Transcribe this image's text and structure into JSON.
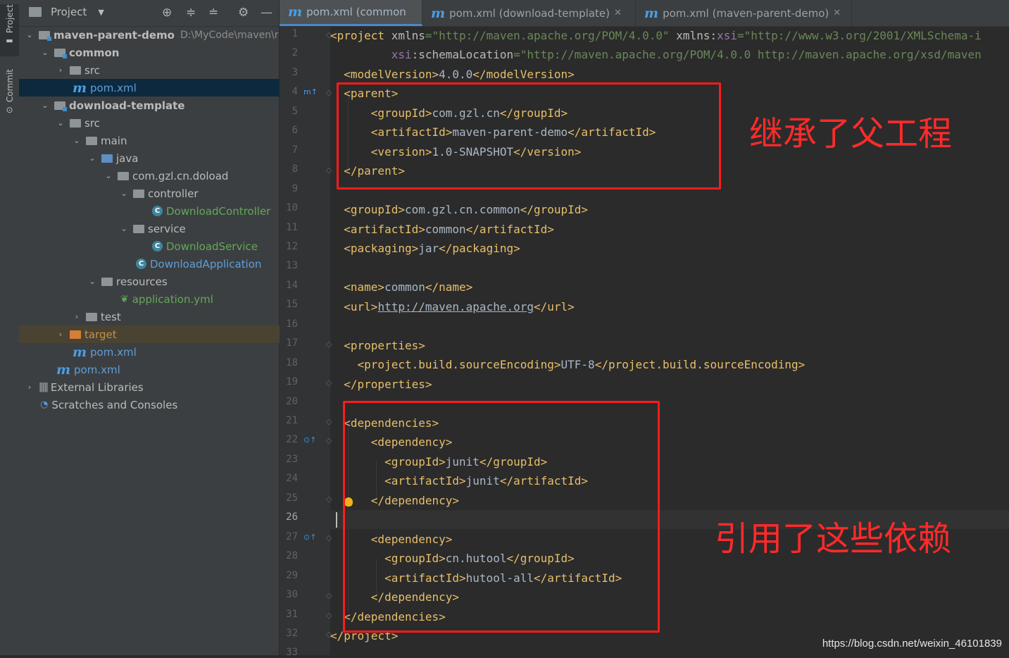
{
  "toolstrip": {
    "project_label": "Project",
    "commit_label": "Commit"
  },
  "project_panel": {
    "title": "Project",
    "tree": [
      {
        "label": "maven-parent-demo",
        "path": "D:\\MyCode\\maven\\r",
        "type": "module"
      },
      {
        "label": "common",
        "type": "module"
      },
      {
        "label": "src",
        "type": "folder"
      },
      {
        "label": "pom.xml",
        "type": "maven"
      },
      {
        "label": "download-template",
        "type": "module"
      },
      {
        "label": "src",
        "type": "folder"
      },
      {
        "label": "main",
        "type": "folder"
      },
      {
        "label": "java",
        "type": "folder"
      },
      {
        "label": "com.gzl.cn.doload",
        "type": "package"
      },
      {
        "label": "controller",
        "type": "package"
      },
      {
        "label": "DownloadController",
        "type": "class"
      },
      {
        "label": "service",
        "type": "package"
      },
      {
        "label": "DownloadService",
        "type": "class"
      },
      {
        "label": "DownloadApplication",
        "type": "app"
      },
      {
        "label": "resources",
        "type": "folder"
      },
      {
        "label": "application.yml",
        "type": "yml"
      },
      {
        "label": "test",
        "type": "folder"
      },
      {
        "label": "target",
        "type": "folder"
      },
      {
        "label": "pom.xml",
        "type": "maven"
      },
      {
        "label": "pom.xml",
        "type": "maven"
      },
      {
        "label": "External Libraries",
        "type": "lib"
      },
      {
        "label": "Scratches and Consoles",
        "type": "scratch"
      }
    ]
  },
  "editor": {
    "tabs": [
      {
        "label": "pom.xml (common",
        "active": true
      },
      {
        "label": "pom.xml (download-template)",
        "active": false
      },
      {
        "label": "pom.xml (maven-parent-demo)",
        "active": false
      }
    ],
    "current_line": 26,
    "line_numbers": [
      "1",
      "2",
      "3",
      "4",
      "5",
      "6",
      "7",
      "8",
      "9",
      "10",
      "11",
      "12",
      "13",
      "14",
      "15",
      "16",
      "17",
      "18",
      "19",
      "20",
      "21",
      "22",
      "23",
      "24",
      "25",
      "26",
      "27",
      "28",
      "29",
      "30",
      "31",
      "32",
      "33"
    ],
    "code": {
      "l1_tag": "<project ",
      "l1_attr1": "xmlns",
      "l1_val1": "=\"http://maven.apache.org/POM/4.0.0\" ",
      "l1_attr2": "xmlns:",
      "l1_ns": "xsi",
      "l1_val2": "=\"http://www.w3.org/2001/XMLSchema-i",
      "l2_ns": "xsi",
      "l2_attr": ":schemaLocation",
      "l2_val": "=\"http://maven.apache.org/POM/4.0.0 http://maven.apache.org/xsd/maven",
      "l3_open": "<modelVersion>",
      "l3_text": "4.0.0",
      "l3_close": "</modelVersion>",
      "l4": "<parent>",
      "l5_open": "<groupId>",
      "l5_text": "com.gzl.cn",
      "l5_close": "</groupId>",
      "l6_open": "<artifactId>",
      "l6_text": "maven-parent-demo",
      "l6_close": "</artifactId>",
      "l7_open": "<version>",
      "l7_text": "1.0-SNAPSHOT",
      "l7_close": "</version>",
      "l8": "</parent>",
      "l10_open": "<groupId>",
      "l10_text": "com.gzl.cn.common",
      "l10_close": "</groupId>",
      "l11_open": "<artifactId>",
      "l11_text": "common",
      "l11_close": "</artifactId>",
      "l12_open": "<packaging>",
      "l12_text": "jar",
      "l12_close": "</packaging>",
      "l14_open": "<name>",
      "l14_text": "common",
      "l14_close": "</name>",
      "l15_open": "<url>",
      "l15_text": "http://maven.apache.org",
      "l15_close": "</url>",
      "l17": "<properties>",
      "l18_open": "<project.build.sourceEncoding>",
      "l18_text": "UTF-8",
      "l18_close": "</project.build.sourceEncoding>",
      "l19": "</properties>",
      "l21": "<dependencies>",
      "l22": "<dependency>",
      "l23_open": "<groupId>",
      "l23_text": "junit",
      "l23_close": "</groupId>",
      "l24_open": "<artifactId>",
      "l24_text": "junit",
      "l24_close": "</artifactId>",
      "l25": "</dependency>",
      "l27": "<dependency>",
      "l28_open": "<groupId>",
      "l28_text": "cn.hutool",
      "l28_close": "</groupId>",
      "l29_open": "<artifactId>",
      "l29_text": "hutool-all",
      "l29_close": "</artifactId>",
      "l30": "</dependency>",
      "l31": "</dependencies>",
      "l32": "</project>"
    }
  },
  "annotations": {
    "parent_note": "继承了父工程",
    "deps_note": "引用了这些依赖"
  },
  "watermark": "https://blog.csdn.net/weixin_46101839",
  "colors": {
    "tag": "#e8bf6a",
    "string": "#6a8759",
    "namespace": "#9876aa",
    "annotation": "#ff1b1b",
    "selection": "#0d293e"
  }
}
